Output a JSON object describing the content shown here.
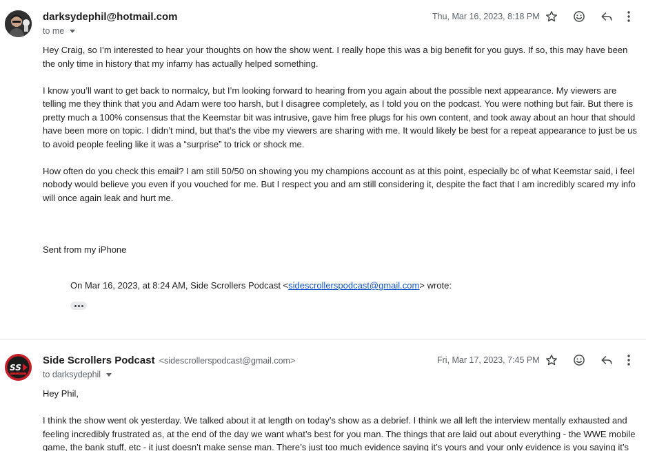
{
  "messages": [
    {
      "sender_name": "darksydephil@hotmail.com",
      "sender_email": "",
      "recipient": "to me",
      "date": "Thu, Mar 16, 2023, 8:18 PM",
      "body": [
        "Hey Craig, so I’m interested to hear your thoughts on how the show went. I really hope this was a big benefit for you guys. If so, this may have been the only time in history that my infamy has actually helped something.",
        "I know you’ll want to get back to normalcy, but I’m looking forward to hearing from you again about the possible next appearance. My viewers are telling me they think that you and Adam were too harsh, but I disagree completely, as I told you on the podcast. You were nothing but fair. But there is pretty much a 100% consensus that the Keemstar bit was intrusive, gave him free plugs for his own content, and took away about an hour that should have been more on topic. I didn’t mind, but that’s the vibe my viewers are sharing with me. It would likely be best for a repeat appearance to just be us to avoid people feeling like it was a “surprise” to trick or shock me.",
        "How often do you check this email? I am still 50/50 on showing you my champions account as at this point, especially bc of what Keemstar said, i feel nobody would believe you even if you vouched for me. But I respect you and am still considering it, despite the fact that I am incredibly scared my info will once again leak and hurt me."
      ],
      "signature": "Sent from my iPhone",
      "quote_prefix": "On Mar 16, 2023, at 8:24 AM, Side Scrollers Podcast <",
      "quote_link": "sidescrollerspodcast@gmail.com",
      "quote_suffix": "> wrote:"
    },
    {
      "sender_name": "Side Scrollers Podcast",
      "sender_email": "<sidescrollerspodcast@gmail.com>",
      "recipient": "to darksydephil",
      "date": "Fri, Mar 17, 2023, 7:45 PM",
      "body": [
        "Hey Phil,",
        "I think the show went ok yesterday. We talked about it at length on today’s show as a debrief. I think we all left the interview mentally exhausted and feeling incredibly frustrated as, at the end of the day we want what’s best for you man. The things that are laid out about everything - the WWE mobile game, the bank stuff, etc - it just doesn’t make sense man. There’s just too much evidence saying it’s yours and your only evidence is you saying it’s"
      ]
    }
  ],
  "icons": {
    "star": "star-icon",
    "emoji": "emoji-reaction-icon",
    "reply": "reply-icon",
    "more": "more-vertical-icon",
    "dropdown": "chevron-down-icon",
    "quote": "ellipsis-icon"
  },
  "colors": {
    "link": "#1155cc",
    "secondary_text": "#5f6368",
    "avatar2_brand": "#c61f2a"
  }
}
